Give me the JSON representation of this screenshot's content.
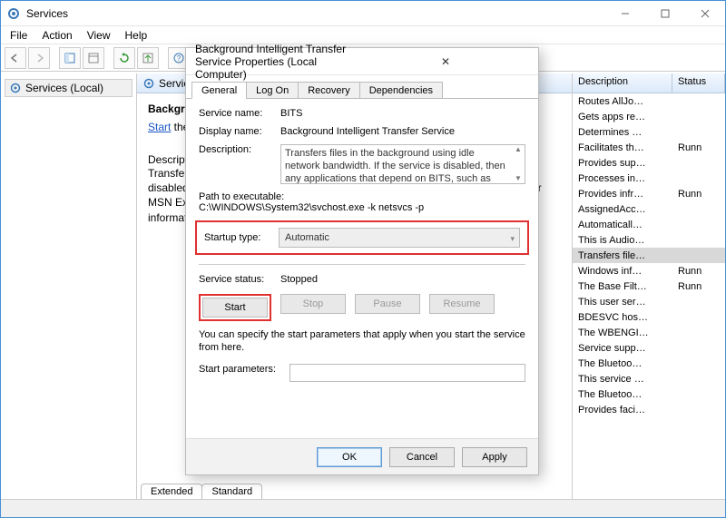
{
  "window": {
    "title": "Services",
    "menus": [
      "File",
      "Action",
      "View",
      "Help"
    ]
  },
  "tree": {
    "root": "Services (Local)"
  },
  "mid": {
    "head": "Services (Local)",
    "svcname": "Background Intelligent Transfer Service",
    "start_link": "Start",
    "start_rest": " the service",
    "desc_label": "Description:",
    "desc_body": "Transfers files in the background using idle network bandwidth. If the service is disabled, then any applications that depend on BITS, such as Windows Update or MSN Explorer, will be unable to automatically download programs and other information."
  },
  "tabs_bottom": {
    "extended": "Extended",
    "standard": "Standard"
  },
  "right": {
    "col_desc": "Description",
    "col_stat": "Status",
    "rows": [
      {
        "d": "Routes AllJo…",
        "s": ""
      },
      {
        "d": "Gets apps re…",
        "s": ""
      },
      {
        "d": "Determines …",
        "s": ""
      },
      {
        "d": "Facilitates th…",
        "s": "Runn"
      },
      {
        "d": "Provides sup…",
        "s": ""
      },
      {
        "d": "Processes in…",
        "s": ""
      },
      {
        "d": "Provides infr…",
        "s": "Runn"
      },
      {
        "d": "AssignedAcc…",
        "s": ""
      },
      {
        "d": "Automaticall…",
        "s": ""
      },
      {
        "d": "This is Audio…",
        "s": ""
      },
      {
        "d": "Transfers file…",
        "s": "",
        "sel": true
      },
      {
        "d": "Windows inf…",
        "s": "Runn"
      },
      {
        "d": "The Base Filt…",
        "s": "Runn"
      },
      {
        "d": "This user ser…",
        "s": ""
      },
      {
        "d": "BDESVC hos…",
        "s": ""
      },
      {
        "d": "The WBENGI…",
        "s": ""
      },
      {
        "d": "Service supp…",
        "s": ""
      },
      {
        "d": "The Bluetoo…",
        "s": ""
      },
      {
        "d": "This service …",
        "s": ""
      },
      {
        "d": "The Bluetoo…",
        "s": ""
      },
      {
        "d": "Provides faci…",
        "s": ""
      }
    ]
  },
  "dialog": {
    "title": "Background Intelligent Transfer Service Properties (Local Computer)",
    "tabs": {
      "general": "General",
      "logon": "Log On",
      "recovery": "Recovery",
      "deps": "Dependencies"
    },
    "labels": {
      "service_name": "Service name:",
      "display_name": "Display name:",
      "description": "Description:",
      "path_label": "Path to executable:",
      "startup_type": "Startup type:",
      "service_status": "Service status:",
      "note": "You can specify the start parameters that apply when you start the service from here.",
      "start_params": "Start parameters:"
    },
    "values": {
      "service_name": "BITS",
      "display_name": "Background Intelligent Transfer Service",
      "description": "Transfers files in the background using idle network bandwidth. If the service is disabled, then any applications that depend on BITS, such as Windows",
      "path": "C:\\WINDOWS\\System32\\svchost.exe -k netsvcs -p",
      "startup_type": "Automatic",
      "service_status": "Stopped"
    },
    "buttons": {
      "start": "Start",
      "stop": "Stop",
      "pause": "Pause",
      "resume": "Resume"
    },
    "footer": {
      "ok": "OK",
      "cancel": "Cancel",
      "apply": "Apply"
    }
  }
}
